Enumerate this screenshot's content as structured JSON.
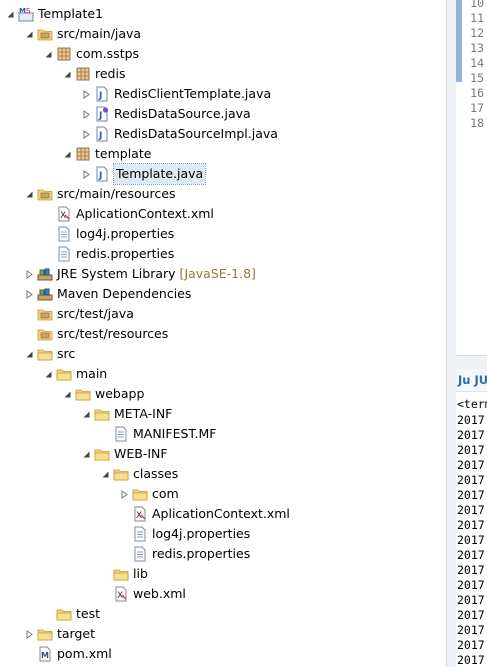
{
  "tree": [
    {
      "label": "Template1",
      "icon": "maven-project-icon",
      "depth": 0,
      "toggle": "expanded"
    },
    {
      "label": "src/main/java",
      "icon": "source-folder-icon",
      "depth": 1,
      "toggle": "expanded"
    },
    {
      "label": "com.sstps",
      "icon": "package-icon",
      "depth": 2,
      "toggle": "expanded"
    },
    {
      "label": "redis",
      "icon": "package-icon",
      "depth": 3,
      "toggle": "expanded"
    },
    {
      "label": "RedisClientTemplate.java",
      "icon": "java-file-icon",
      "depth": 4,
      "toggle": "collapsed"
    },
    {
      "label": "RedisDataSource.java",
      "icon": "java-interface-file-icon",
      "depth": 4,
      "toggle": "collapsed"
    },
    {
      "label": "RedisDataSourceImpl.java",
      "icon": "java-file-icon",
      "depth": 4,
      "toggle": "collapsed"
    },
    {
      "label": "template",
      "icon": "package-icon",
      "depth": 3,
      "toggle": "expanded"
    },
    {
      "label": "Template.java",
      "icon": "java-file-icon",
      "depth": 4,
      "toggle": "collapsed",
      "selected": true
    },
    {
      "label": "src/main/resources",
      "icon": "source-folder-icon",
      "depth": 1,
      "toggle": "expanded"
    },
    {
      "label": "AplicationContext.xml",
      "icon": "xml-file-icon",
      "depth": 2,
      "toggle": "none"
    },
    {
      "label": "log4j.properties",
      "icon": "properties-file-icon",
      "depth": 2,
      "toggle": "none"
    },
    {
      "label": "redis.properties",
      "icon": "properties-file-icon",
      "depth": 2,
      "toggle": "none"
    },
    {
      "label": "JRE System Library",
      "icon": "library-icon",
      "depth": 1,
      "toggle": "collapsed",
      "decoration": "[JavaSE-1.8]"
    },
    {
      "label": "Maven Dependencies",
      "icon": "library-icon",
      "depth": 1,
      "toggle": "collapsed"
    },
    {
      "label": "src/test/java",
      "icon": "source-folder-icon",
      "depth": 1,
      "toggle": "none"
    },
    {
      "label": "src/test/resources",
      "icon": "source-folder-icon",
      "depth": 1,
      "toggle": "none"
    },
    {
      "label": "src",
      "icon": "folder-icon",
      "depth": 1,
      "toggle": "expanded"
    },
    {
      "label": "main",
      "icon": "folder-icon",
      "depth": 2,
      "toggle": "expanded"
    },
    {
      "label": "webapp",
      "icon": "folder-icon",
      "depth": 3,
      "toggle": "expanded"
    },
    {
      "label": "META-INF",
      "icon": "folder-icon",
      "depth": 4,
      "toggle": "expanded"
    },
    {
      "label": "MANIFEST.MF",
      "icon": "text-file-icon",
      "depth": 5,
      "toggle": "none"
    },
    {
      "label": "WEB-INF",
      "icon": "folder-icon",
      "depth": 4,
      "toggle": "expanded"
    },
    {
      "label": "classes",
      "icon": "folder-icon",
      "depth": 5,
      "toggle": "expanded"
    },
    {
      "label": "com",
      "icon": "folder-icon",
      "depth": 6,
      "toggle": "collapsed"
    },
    {
      "label": "AplicationContext.xml",
      "icon": "xml-file-icon",
      "depth": 6,
      "toggle": "none"
    },
    {
      "label": "log4j.properties",
      "icon": "properties-file-icon",
      "depth": 6,
      "toggle": "none"
    },
    {
      "label": "redis.properties",
      "icon": "properties-file-icon",
      "depth": 6,
      "toggle": "none"
    },
    {
      "label": "lib",
      "icon": "folder-icon",
      "depth": 5,
      "toggle": "none"
    },
    {
      "label": "web.xml",
      "icon": "xml-file-icon",
      "depth": 5,
      "toggle": "none"
    },
    {
      "label": "test",
      "icon": "folder-icon",
      "depth": 2,
      "toggle": "none"
    },
    {
      "label": "target",
      "icon": "folder-icon",
      "depth": 1,
      "toggle": "collapsed"
    },
    {
      "label": "pom.xml",
      "icon": "maven-pom-icon",
      "depth": 1,
      "toggle": "none"
    }
  ],
  "editor": {
    "line_numbers": [
      "10",
      "11",
      "12",
      "13",
      "14",
      "15",
      "16",
      "17",
      "18"
    ]
  },
  "junit": {
    "tab_label": "Ju JU",
    "console_header": "<term",
    "console_lines": [
      "2017",
      "2017",
      "2017",
      "2017",
      "2017",
      "2017",
      "2017",
      "2017",
      "2017",
      "2017",
      "2017",
      "2017",
      "2017",
      "2017",
      "2017",
      "2017",
      "2017",
      "2017"
    ]
  },
  "colors": {
    "folder": "#e9c46a",
    "package_brown": "#b07a3c",
    "java_blue": "#3a66b0",
    "selection": "#ddeaf8",
    "decoration": "#9a7a34",
    "console_text": "#000000"
  }
}
